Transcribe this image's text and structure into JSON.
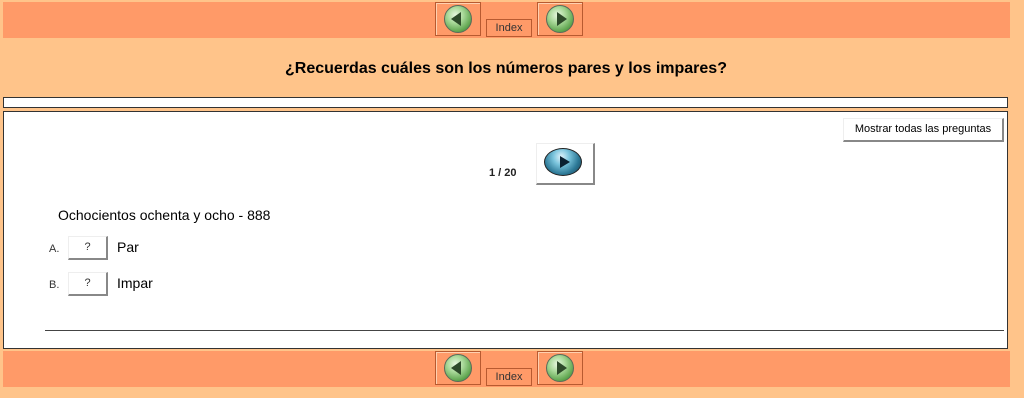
{
  "nav": {
    "prev_icon": "left-arrow-circle-icon",
    "next_icon": "right-arrow-circle-icon",
    "index_label": "Index"
  },
  "question_title": "¿Recuerdas cuáles son los números pares y los impares?",
  "quiz": {
    "show_all_label": "Mostrar todas las preguntas",
    "counter": "1 / 20",
    "prompt": "Ochocientos ochenta y ocho - 888",
    "options": [
      {
        "letter": "A.",
        "button": "?",
        "text": "Par"
      },
      {
        "letter": "B.",
        "button": "?",
        "text": "Impar"
      }
    ]
  },
  "colors": {
    "page_bg": "#ffc48a",
    "nav_bg": "#ff9a68",
    "panel_bg": "#ffffff"
  }
}
